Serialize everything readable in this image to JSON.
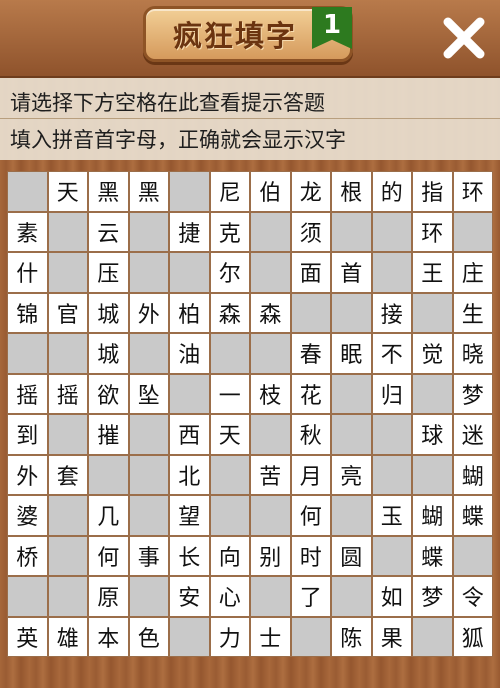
{
  "header": {
    "title": "疯狂填字",
    "level": "1",
    "close_icon": "close-icon"
  },
  "hints": {
    "line1": "请选择下方空格在此查看提示答题",
    "line2": "填入拼音首字母，正确就会显示汉字"
  },
  "board": {
    "rows": [
      [
        "",
        "天",
        "黑",
        "黑",
        "",
        "尼",
        "伯",
        "龙",
        "根",
        "的",
        "指",
        "环"
      ],
      [
        "素",
        "",
        "云",
        "",
        "捷",
        "克",
        "",
        "须",
        "",
        "",
        "环",
        ""
      ],
      [
        "什",
        "",
        "压",
        "",
        "",
        "尔",
        "",
        "面",
        "首",
        "",
        "王",
        "庄"
      ],
      [
        "锦",
        "官",
        "城",
        "外",
        "柏",
        "森",
        "森",
        "",
        "",
        "接",
        "",
        "生"
      ],
      [
        "",
        "",
        "城",
        "",
        "油",
        "",
        "",
        "春",
        "眠",
        "不",
        "觉",
        "晓"
      ],
      [
        "摇",
        "摇",
        "欲",
        "坠",
        "",
        "一",
        "枝",
        "花",
        "",
        "归",
        "",
        "梦"
      ],
      [
        "到",
        "",
        "摧",
        "",
        "西",
        "天",
        "",
        "秋",
        "",
        "",
        "球",
        "迷"
      ],
      [
        "外",
        "套",
        "",
        "",
        "北",
        "",
        "苦",
        "月",
        "亮",
        "",
        "",
        "蝴"
      ],
      [
        "婆",
        "",
        "几",
        "",
        "望",
        "",
        "",
        "何",
        "",
        "玉",
        "蝴",
        "蝶"
      ],
      [
        "桥",
        "",
        "何",
        "事",
        "长",
        "向",
        "别",
        "时",
        "圆",
        "",
        "蝶",
        ""
      ],
      [
        "",
        "",
        "原",
        "",
        "安",
        "心",
        "",
        "了",
        "",
        "如",
        "梦",
        "令"
      ],
      [
        "英",
        "雄",
        "本",
        "色",
        "",
        "力",
        "士",
        "",
        "陈",
        "果",
        "",
        "狐"
      ]
    ]
  }
}
